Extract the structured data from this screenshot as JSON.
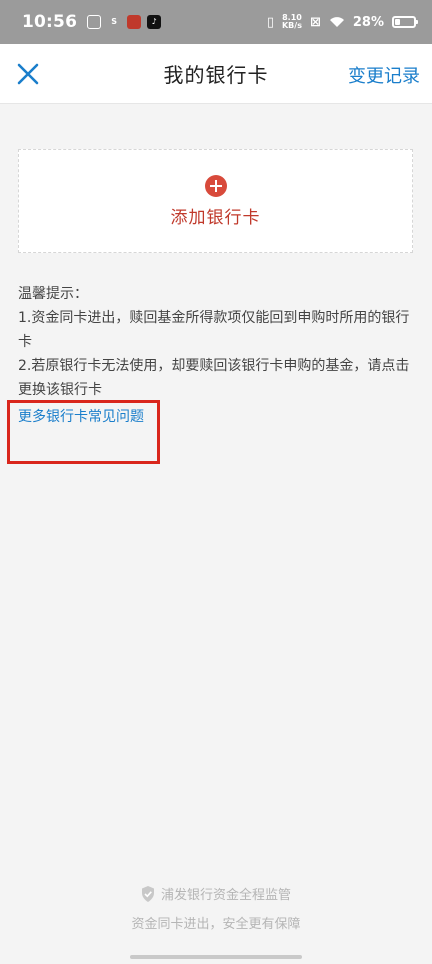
{
  "status_bar": {
    "time": "10:56",
    "net_speed_top": "8.10",
    "net_speed_bottom": "KB/s",
    "battery": "28%",
    "battery_level": 0.28
  },
  "nav": {
    "title": "我的银行卡",
    "action": "变更记录"
  },
  "add_card": {
    "label": "添加银行卡"
  },
  "tips": {
    "heading": "温馨提示：",
    "item1": "1.资金同卡进出，赎回基金所得款项仅能回到申购时所用的银行卡",
    "item2": "2.若原银行卡无法使用，却要赎回该银行卡申购的基金，请点击更换该银行卡"
  },
  "faq_link": "更多银行卡常见问题",
  "footer": {
    "line1": "浦发银行资金全程监管",
    "line2": "资金同卡进出，安全更有保障"
  },
  "colors": {
    "accent_blue": "#1a7ecb",
    "accent_red": "#d84a3b",
    "highlight_red": "#d9261c"
  }
}
